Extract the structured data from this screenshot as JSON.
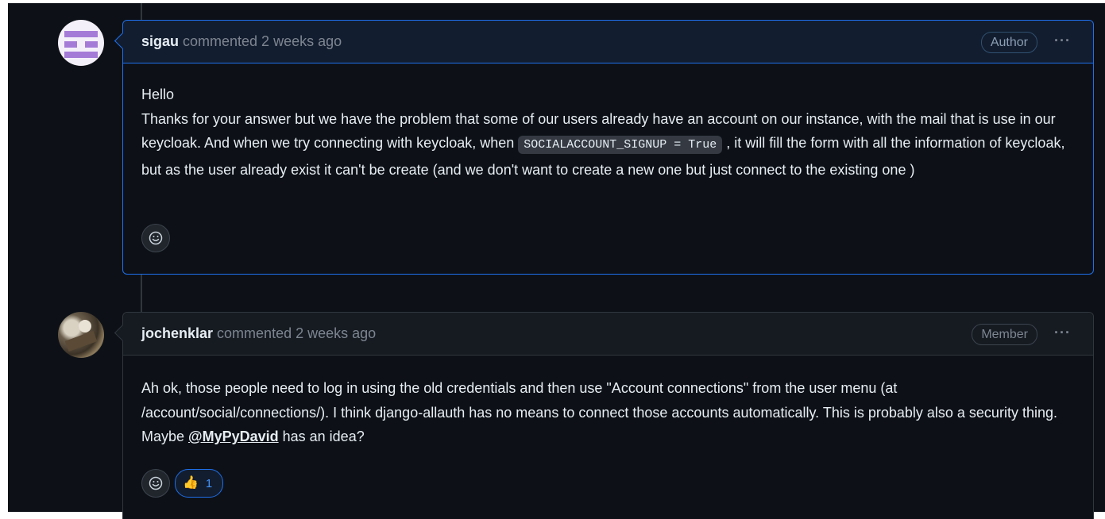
{
  "comments": [
    {
      "author": "sigau",
      "meta": "commented 2 weeks ago",
      "badge": "Author",
      "more": "···",
      "body": {
        "line1": "Hello",
        "line2_before": "Thanks for your answer but we have the problem that some of our users already have an account on our instance, with the mail that is use in our keycloak. And when we try connecting with keycloak, when ",
        "code": "SOCIALACCOUNT_SIGNUP = True",
        "line2_after": " , it will fill the form with all the information of keycloak, but as the user already exist it can't be create (and we don't want to create a new one but just connect to the existing one )"
      }
    },
    {
      "author": "jochenklar",
      "meta": "commented 2 weeks ago",
      "badge": "Member",
      "more": "···",
      "body": {
        "before": "Ah ok, those people need to log in using the old credentials and then use \"Account connections\" from the user menu (at /account/social/connections/). I think django-allauth has no means to connect those accounts automatically. This is probably also a security thing. Maybe ",
        "mention": "@MyPyDavid",
        "after": " has an idea?"
      },
      "reaction": {
        "emoji": "👍",
        "count": "1"
      }
    }
  ],
  "icons": {
    "add_reaction": "smiley-icon",
    "more": "kebab-horizontal-icon",
    "thumbs_up": "thumbs-up-icon"
  },
  "colors": {
    "accent": "#1f6feb",
    "background": "#0d1117",
    "muted": "#7d8590"
  }
}
